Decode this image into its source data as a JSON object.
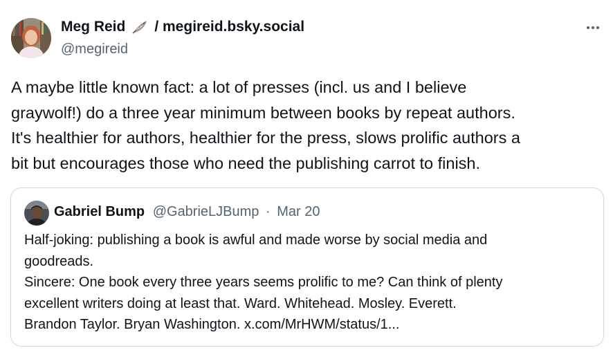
{
  "author": {
    "name": "Meg Reid",
    "name_suffix": "/ megireid.bsky.social",
    "handle": "@megireid"
  },
  "tweet": {
    "lines": [
      "A maybe little known fact: a lot of presses (incl. us and I believe",
      "graywolf!) do a three year minimum between books by repeat authors.",
      "It's healthier for authors, healthier for the press, slows prolific authors a",
      "bit but encourages those who need the publishing carrot to finish."
    ]
  },
  "quoted": {
    "name": "Gabriel Bump",
    "handle": "@GabrieLJBump",
    "separator": "·",
    "date": "Mar 20",
    "lines": [
      "Half-joking: publishing a book is awful and made worse by social media and",
      "goodreads.",
      "Sincere: One book every three years seems prolific to me? Can think of plenty",
      "excellent writers doing at least that. Ward. Whitehead. Mosley. Everett.",
      "Brandon Taylor. Bryan Washington. x.com/MrHWM/status/1..."
    ]
  },
  "icons": {
    "more": "more-horizontal-icon",
    "feather": "feather-emoji-icon"
  },
  "colors": {
    "text": "#0f1419",
    "secondary": "#536471",
    "border": "#cfd9de"
  }
}
